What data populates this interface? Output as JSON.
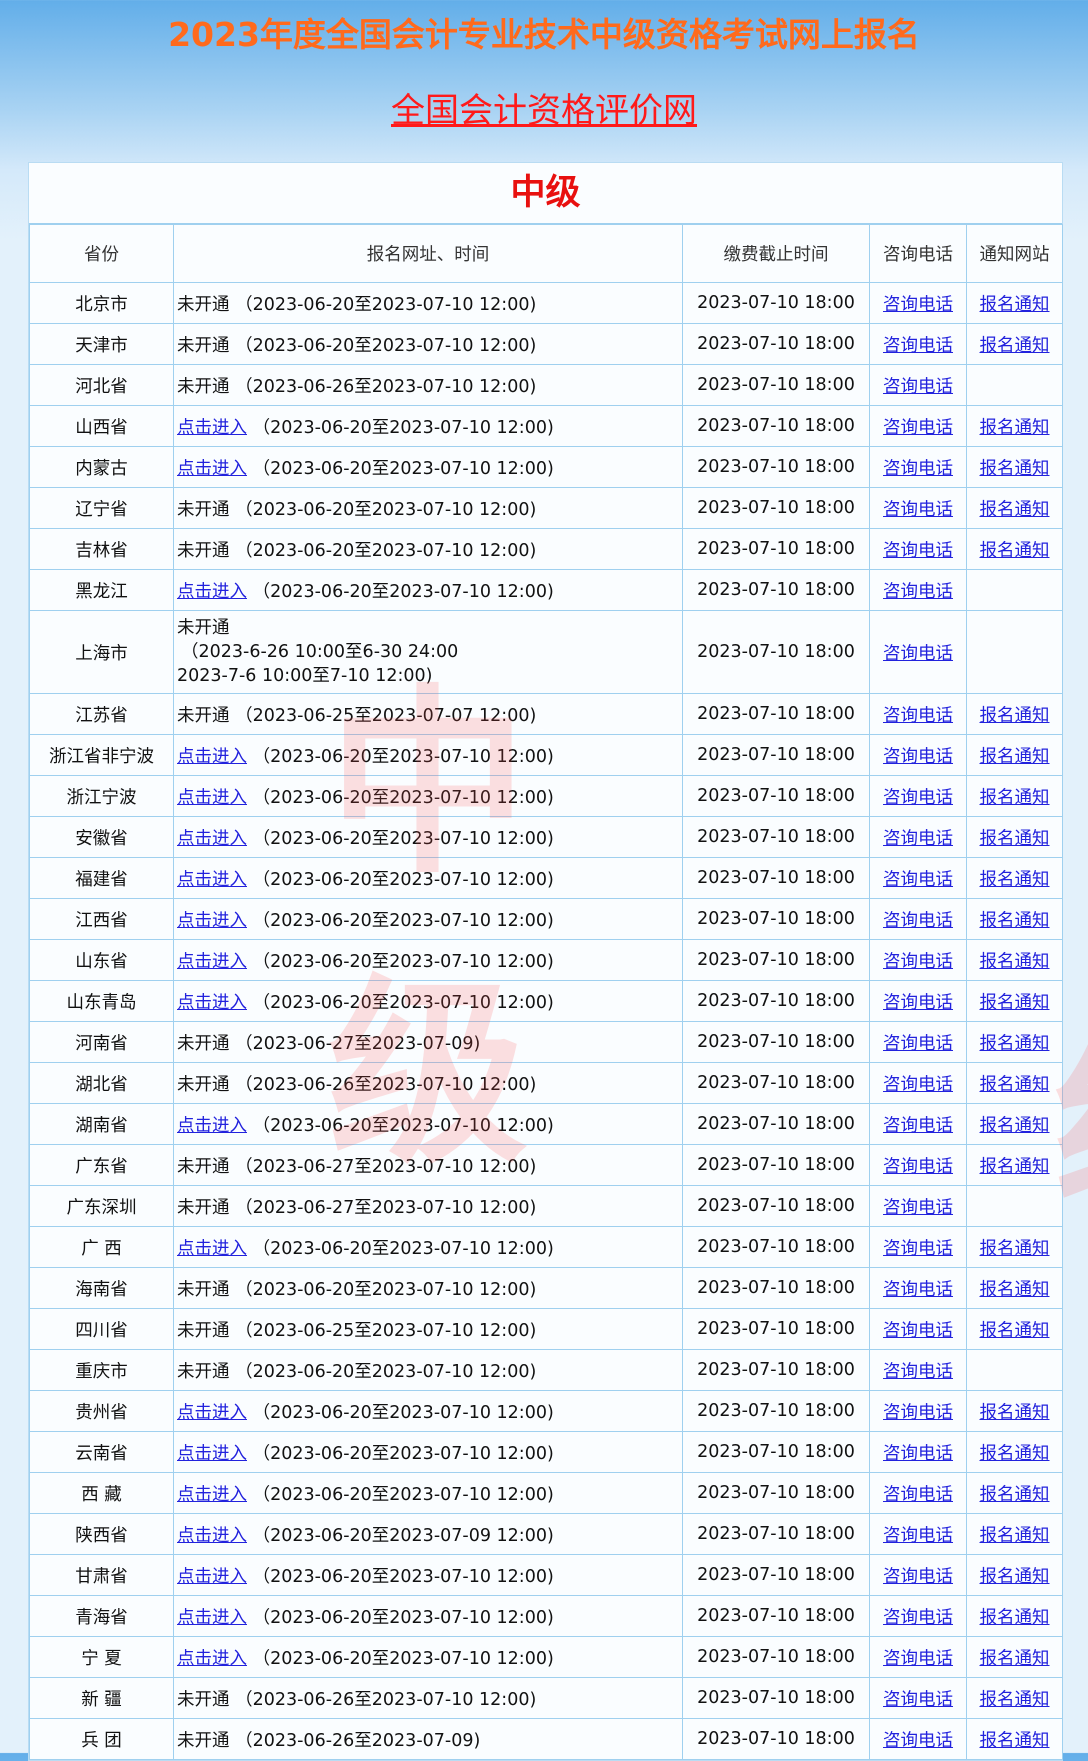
{
  "header": {
    "title": "2023年度全国会计专业技术中级资格考试网上报名",
    "site_link": "全国会计资格评价网"
  },
  "panel": {
    "heading": "中级",
    "watermark": [
      "中",
      "级"
    ],
    "columns": [
      "省份",
      "报名网址、时间",
      "缴费截止时间",
      "咨询电话",
      "通知网站"
    ]
  },
  "rows": [
    {
      "province": "北京市",
      "status": "未开通",
      "status_link": false,
      "period": "（2023-06-20至2023-07-10 12:00)",
      "fee_deadline": "2023-07-10 18:00",
      "phone": "咨询电话",
      "notice": "报名通知"
    },
    {
      "province": "天津市",
      "status": "未开通",
      "status_link": false,
      "period": "（2023-06-20至2023-07-10 12:00)",
      "fee_deadline": "2023-07-10 18:00",
      "phone": "咨询电话",
      "notice": "报名通知"
    },
    {
      "province": "河北省",
      "status": "未开通",
      "status_link": false,
      "period": "（2023-06-26至2023-07-10 12:00)",
      "fee_deadline": "2023-07-10 18:00",
      "phone": "咨询电话",
      "notice": ""
    },
    {
      "province": "山西省",
      "status": "点击进入",
      "status_link": true,
      "period": "（2023-06-20至2023-07-10 12:00)",
      "fee_deadline": "2023-07-10 18:00",
      "phone": "咨询电话",
      "notice": "报名通知"
    },
    {
      "province": "内蒙古",
      "status": "点击进入",
      "status_link": true,
      "period": "（2023-06-20至2023-07-10 12:00)",
      "fee_deadline": "2023-07-10 18:00",
      "phone": "咨询电话",
      "notice": "报名通知"
    },
    {
      "province": "辽宁省",
      "status": "未开通",
      "status_link": false,
      "period": "（2023-06-20至2023-07-10 12:00)",
      "fee_deadline": "2023-07-10 18:00",
      "phone": "咨询电话",
      "notice": "报名通知"
    },
    {
      "province": "吉林省",
      "status": "未开通",
      "status_link": false,
      "period": "（2023-06-20至2023-07-10 12:00)",
      "fee_deadline": "2023-07-10 18:00",
      "phone": "咨询电话",
      "notice": "报名通知"
    },
    {
      "province": "黑龙江",
      "status": "点击进入",
      "status_link": true,
      "period": "（2023-06-20至2023-07-10 12:00)",
      "fee_deadline": "2023-07-10 18:00",
      "phone": "咨询电话",
      "notice": ""
    },
    {
      "province": "上海市",
      "status": "未开通",
      "status_link": false,
      "period_lines": [
        "（2023-6-26 10:00至6-30 24:00",
        "2023-7-6 10:00至7-10 12:00)"
      ],
      "fee_deadline": "2023-07-10 18:00",
      "phone": "咨询电话",
      "notice": ""
    },
    {
      "province": "江苏省",
      "status": "未开通",
      "status_link": false,
      "period": "（2023-06-25至2023-07-07 12:00)",
      "fee_deadline": "2023-07-10 18:00",
      "phone": "咨询电话",
      "notice": "报名通知"
    },
    {
      "province": "浙江省非宁波",
      "status": "点击进入",
      "status_link": true,
      "period": "（2023-06-20至2023-07-10 12:00)",
      "fee_deadline": "2023-07-10 18:00",
      "phone": "咨询电话",
      "notice": "报名通知"
    },
    {
      "province": "浙江宁波",
      "status": "点击进入",
      "status_link": true,
      "period": "（2023-06-20至2023-07-10 12:00)",
      "fee_deadline": "2023-07-10 18:00",
      "phone": "咨询电话",
      "notice": "报名通知"
    },
    {
      "province": "安徽省",
      "status": "点击进入",
      "status_link": true,
      "period": "（2023-06-20至2023-07-10 12:00)",
      "fee_deadline": "2023-07-10 18:00",
      "phone": "咨询电话",
      "notice": "报名通知"
    },
    {
      "province": "福建省",
      "status": "点击进入",
      "status_link": true,
      "period": "（2023-06-20至2023-07-10 12:00)",
      "fee_deadline": "2023-07-10 18:00",
      "phone": "咨询电话",
      "notice": "报名通知"
    },
    {
      "province": "江西省",
      "status": "点击进入",
      "status_link": true,
      "period": "（2023-06-20至2023-07-10 12:00)",
      "fee_deadline": "2023-07-10 18:00",
      "phone": "咨询电话",
      "notice": "报名通知"
    },
    {
      "province": "山东省",
      "status": "点击进入",
      "status_link": true,
      "period": "（2023-06-20至2023-07-10 12:00)",
      "fee_deadline": "2023-07-10 18:00",
      "phone": "咨询电话",
      "notice": "报名通知"
    },
    {
      "province": "山东青岛",
      "status": "点击进入",
      "status_link": true,
      "period": "（2023-06-20至2023-07-10 12:00)",
      "fee_deadline": "2023-07-10 18:00",
      "phone": "咨询电话",
      "notice": "报名通知"
    },
    {
      "province": "河南省",
      "status": "未开通",
      "status_link": false,
      "period": "（2023-06-27至2023-07-09)",
      "fee_deadline": "2023-07-10 18:00",
      "phone": "咨询电话",
      "notice": "报名通知"
    },
    {
      "province": "湖北省",
      "status": "未开通",
      "status_link": false,
      "period": "（2023-06-26至2023-07-10 12:00)",
      "fee_deadline": "2023-07-10 18:00",
      "phone": "咨询电话",
      "notice": "报名通知"
    },
    {
      "province": "湖南省",
      "status": "点击进入",
      "status_link": true,
      "period": "（2023-06-20至2023-07-10 12:00)",
      "fee_deadline": "2023-07-10 18:00",
      "phone": "咨询电话",
      "notice": "报名通知"
    },
    {
      "province": "广东省",
      "status": "未开通",
      "status_link": false,
      "period": "（2023-06-27至2023-07-10 12:00)",
      "fee_deadline": "2023-07-10 18:00",
      "phone": "咨询电话",
      "notice": "报名通知"
    },
    {
      "province": "广东深圳",
      "status": "未开通",
      "status_link": false,
      "period": "（2023-06-27至2023-07-10 12:00)",
      "fee_deadline": "2023-07-10 18:00",
      "phone": "咨询电话",
      "notice": ""
    },
    {
      "province": "广 西",
      "status": "点击进入",
      "status_link": true,
      "period": "（2023-06-20至2023-07-10 12:00)",
      "fee_deadline": "2023-07-10 18:00",
      "phone": "咨询电话",
      "notice": "报名通知"
    },
    {
      "province": "海南省",
      "status": "未开通",
      "status_link": false,
      "period": "（2023-06-20至2023-07-10 12:00)",
      "fee_deadline": "2023-07-10 18:00",
      "phone": "咨询电话",
      "notice": "报名通知"
    },
    {
      "province": "四川省",
      "status": "未开通",
      "status_link": false,
      "period": "（2023-06-25至2023-07-10 12:00)",
      "fee_deadline": "2023-07-10 18:00",
      "phone": "咨询电话",
      "notice": "报名通知"
    },
    {
      "province": "重庆市",
      "status": "未开通",
      "status_link": false,
      "period": "（2023-06-20至2023-07-10 12:00)",
      "fee_deadline": "2023-07-10 18:00",
      "phone": "咨询电话",
      "notice": ""
    },
    {
      "province": "贵州省",
      "status": "点击进入",
      "status_link": true,
      "period": "（2023-06-20至2023-07-10 12:00)",
      "fee_deadline": "2023-07-10 18:00",
      "phone": "咨询电话",
      "notice": "报名通知"
    },
    {
      "province": "云南省",
      "status": "点击进入",
      "status_link": true,
      "period": "（2023-06-20至2023-07-10 12:00)",
      "fee_deadline": "2023-07-10 18:00",
      "phone": "咨询电话",
      "notice": "报名通知"
    },
    {
      "province": "西 藏",
      "status": "点击进入",
      "status_link": true,
      "period": "（2023-06-20至2023-07-10 12:00)",
      "fee_deadline": "2023-07-10 18:00",
      "phone": "咨询电话",
      "notice": "报名通知"
    },
    {
      "province": "陕西省",
      "status": "点击进入",
      "status_link": true,
      "period": "（2023-06-20至2023-07-09 12:00)",
      "fee_deadline": "2023-07-10 18:00",
      "phone": "咨询电话",
      "notice": "报名通知"
    },
    {
      "province": "甘肃省",
      "status": "点击进入",
      "status_link": true,
      "period": "（2023-06-20至2023-07-10 12:00)",
      "fee_deadline": "2023-07-10 18:00",
      "phone": "咨询电话",
      "notice": "报名通知"
    },
    {
      "province": "青海省",
      "status": "点击进入",
      "status_link": true,
      "period": "（2023-06-20至2023-07-10 12:00)",
      "fee_deadline": "2023-07-10 18:00",
      "phone": "咨询电话",
      "notice": "报名通知"
    },
    {
      "province": "宁 夏",
      "status": "点击进入",
      "status_link": true,
      "period": "（2023-06-20至2023-07-10 12:00)",
      "fee_deadline": "2023-07-10 18:00",
      "phone": "咨询电话",
      "notice": "报名通知"
    },
    {
      "province": "新 疆",
      "status": "未开通",
      "status_link": false,
      "period": "（2023-06-26至2023-07-10 12:00)",
      "fee_deadline": "2023-07-10 18:00",
      "phone": "咨询电话",
      "notice": "报名通知"
    },
    {
      "province": "兵 团",
      "status": "未开通",
      "status_link": false,
      "period": "（2023-06-26至2023-07-09)",
      "fee_deadline": "2023-07-10 18:00",
      "phone": "咨询电话",
      "notice": "报名通知"
    }
  ]
}
